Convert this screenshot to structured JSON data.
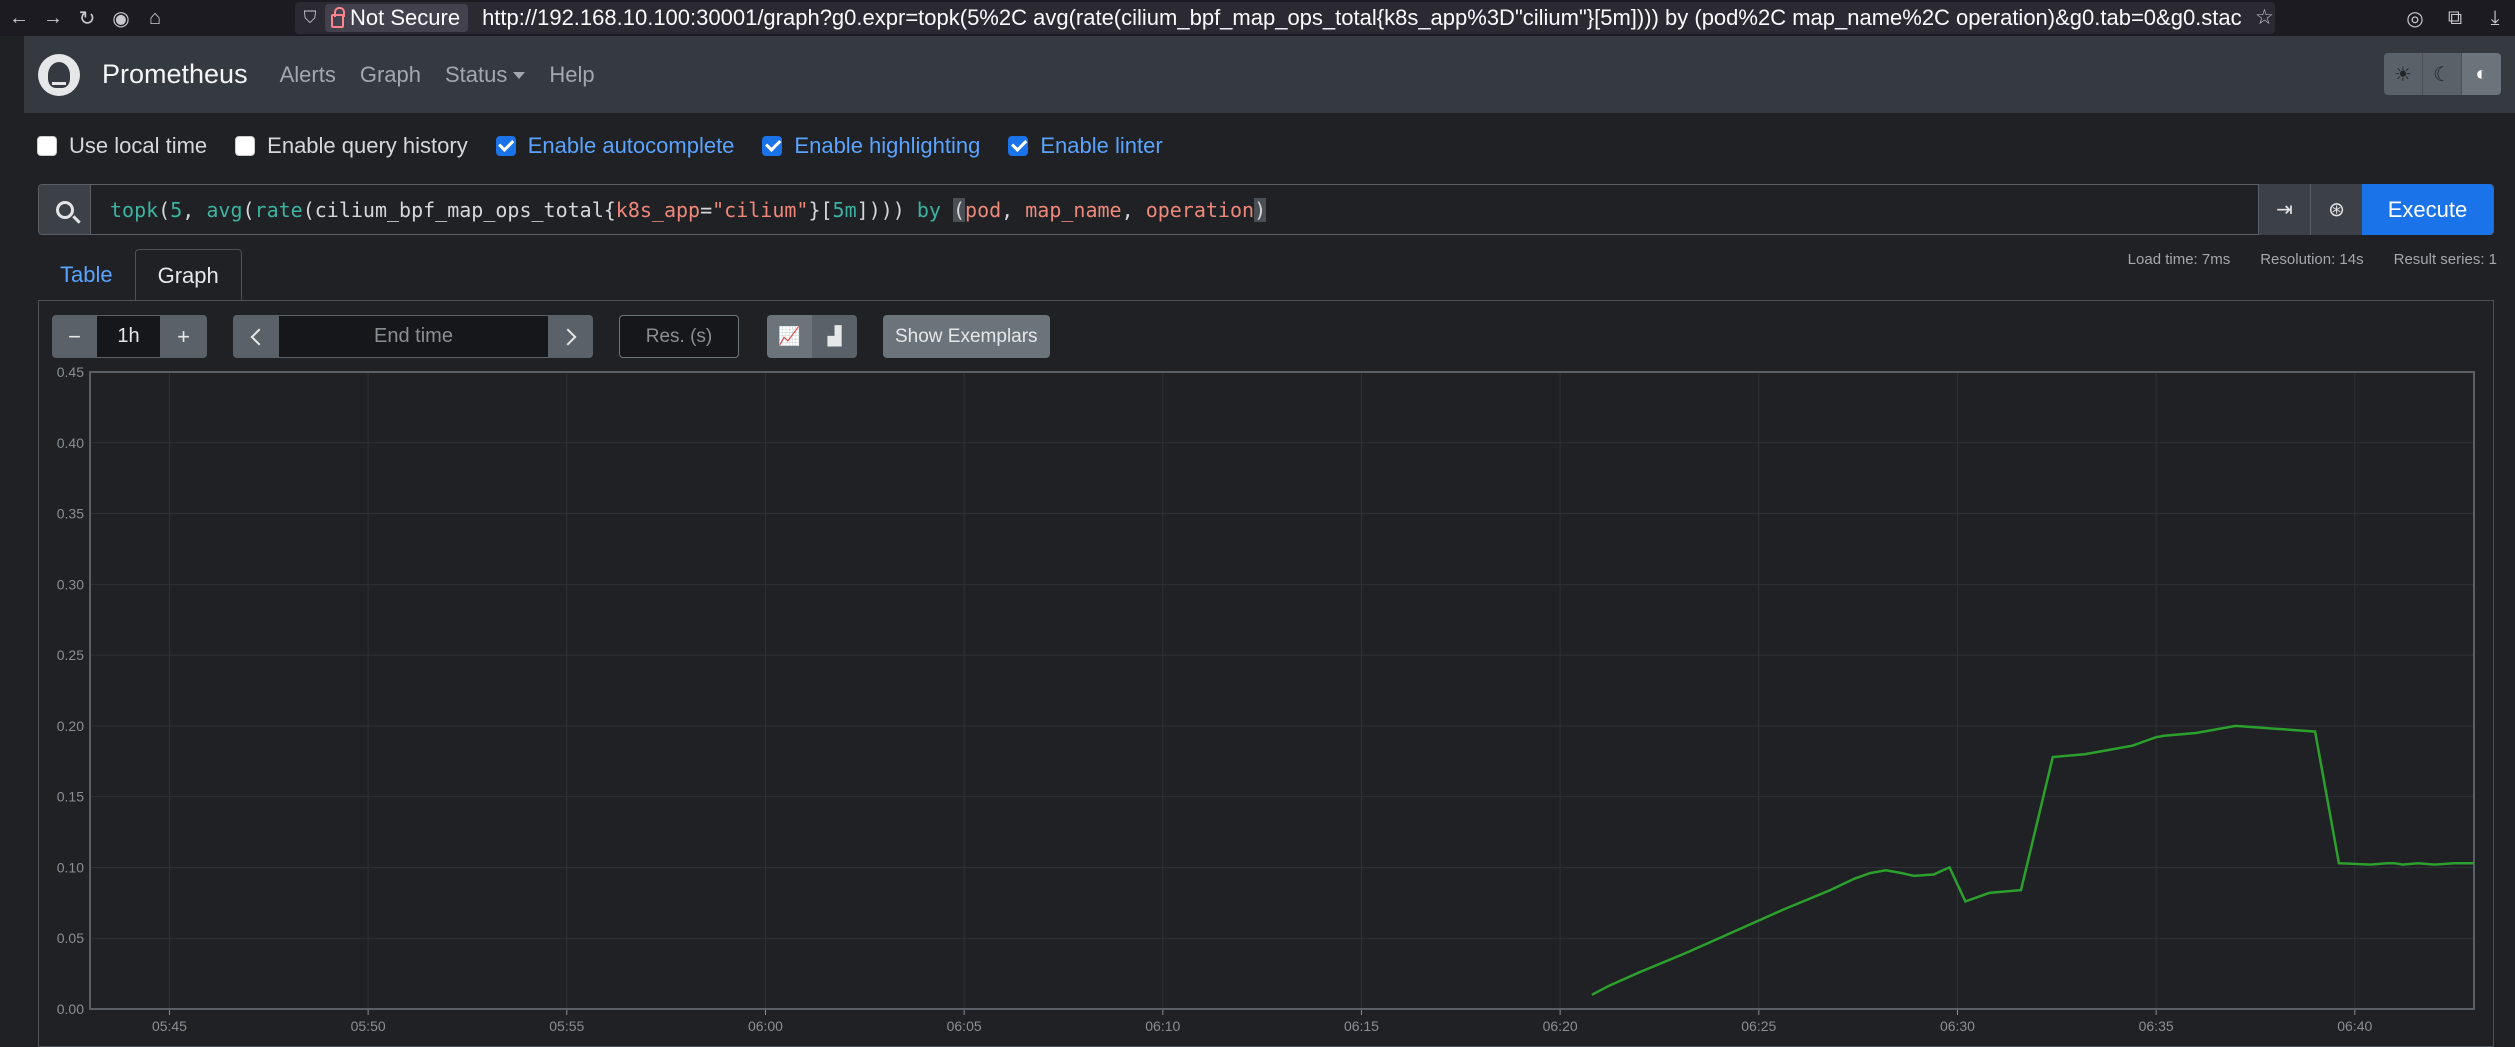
{
  "browser": {
    "not_secure": "Not Secure",
    "url_host": "http://192.168.10.100",
    "url_rest": ":30001/graph?g0.expr=topk(5%2C avg(rate(cilium_bpf_map_ops_total{k8s_app%3D\"cilium\"}[5m]))) by (pod%2C map_name%2C operation)&g0.tab=0&g0.stac"
  },
  "navbar": {
    "brand": "Prometheus",
    "links": [
      "Alerts",
      "Graph",
      "Status",
      "Help"
    ]
  },
  "options": {
    "use_local_time": {
      "label": "Use local time",
      "checked": false
    },
    "query_history": {
      "label": "Enable query history",
      "checked": false
    },
    "autocomplete": {
      "label": "Enable autocomplete",
      "checked": true
    },
    "highlighting": {
      "label": "Enable highlighting",
      "checked": true
    },
    "linter": {
      "label": "Enable linter",
      "checked": true
    }
  },
  "query": {
    "tokens": [
      {
        "t": "topk",
        "c": "c-fn"
      },
      {
        "t": "(",
        "c": "c-br"
      },
      {
        "t": "5",
        "c": "c-num"
      },
      {
        "t": ", ",
        "c": "c-br"
      },
      {
        "t": "avg",
        "c": "c-fn"
      },
      {
        "t": "(",
        "c": "c-br"
      },
      {
        "t": "rate",
        "c": "c-fn"
      },
      {
        "t": "(",
        "c": "c-br"
      },
      {
        "t": "cilium_bpf_map_ops_total",
        "c": "c-id"
      },
      {
        "t": "{",
        "c": "c-br"
      },
      {
        "t": "k8s_app",
        "c": "c-lbl"
      },
      {
        "t": "=",
        "c": "c-br"
      },
      {
        "t": "\"cilium\"",
        "c": "c-str"
      },
      {
        "t": "}",
        "c": "c-br"
      },
      {
        "t": "[",
        "c": "c-br"
      },
      {
        "t": "5m",
        "c": "c-num"
      },
      {
        "t": "]",
        "c": "c-br"
      },
      {
        "t": "))) ",
        "c": "c-br"
      },
      {
        "t": "by",
        "c": "c-kw"
      },
      {
        "t": " ",
        "c": "c-br"
      },
      {
        "t": "(",
        "c": "c-br c-hl"
      },
      {
        "t": "pod",
        "c": "c-lbl"
      },
      {
        "t": ", ",
        "c": "c-br"
      },
      {
        "t": "map_name",
        "c": "c-lbl"
      },
      {
        "t": ", ",
        "c": "c-br"
      },
      {
        "t": "operation",
        "c": "c-lbl"
      },
      {
        "t": ")",
        "c": "c-br c-hl"
      }
    ],
    "execute_label": "Execute"
  },
  "meta": {
    "load_time": "Load time: 7ms",
    "resolution": "Resolution: 14s",
    "result_series": "Result series: 1"
  },
  "tabs": {
    "table": "Table",
    "graph": "Graph"
  },
  "controls": {
    "range_minus": "−",
    "range": "1h",
    "range_plus": "+",
    "end_time_placeholder": "End time",
    "res_placeholder": "Res. (s)",
    "show_exemplars": "Show Exemplars"
  },
  "colors": {
    "series": "#2ca02c",
    "grid": "#2e3237",
    "axis_text": "#8a8f95"
  },
  "chart_data": {
    "type": "line",
    "x_ticks": [
      "05:45",
      "05:50",
      "05:55",
      "06:00",
      "06:05",
      "06:10",
      "06:15",
      "06:20",
      "06:25",
      "06:30",
      "06:35",
      "06:40"
    ],
    "y_ticks": [
      "0.00",
      "0.05",
      "0.10",
      "0.15",
      "0.20",
      "0.25",
      "0.30",
      "0.35",
      "0.40",
      "0.45"
    ],
    "ylim": [
      0,
      0.45
    ],
    "xlim_minutes": [
      343,
      403
    ],
    "series": [
      {
        "x_minutes": [
          380.8,
          381.2,
          382.0,
          383.2,
          384.4,
          385.6,
          386.2,
          386.8,
          387.4,
          387.8,
          388.2,
          388.6,
          388.9,
          389.4,
          389.8,
          390.2,
          390.8,
          391.6,
          392.4,
          393.2,
          393.8,
          394.4,
          394.8,
          395.0,
          395.2,
          396.0,
          397.0,
          398.0,
          399.0,
          399.6,
          400.4,
          400.8,
          401.0,
          401.2,
          401.6,
          402.0,
          402.5,
          403.0
        ],
        "values": [
          0.01,
          0.016,
          0.026,
          0.04,
          0.055,
          0.07,
          0.077,
          0.084,
          0.092,
          0.096,
          0.098,
          0.096,
          0.094,
          0.095,
          0.1,
          0.076,
          0.082,
          0.084,
          0.178,
          0.18,
          0.183,
          0.186,
          0.19,
          0.192,
          0.193,
          0.195,
          0.2,
          0.198,
          0.196,
          0.103,
          0.102,
          0.103,
          0.103,
          0.102,
          0.103,
          0.102,
          0.103,
          0.103
        ]
      }
    ]
  }
}
